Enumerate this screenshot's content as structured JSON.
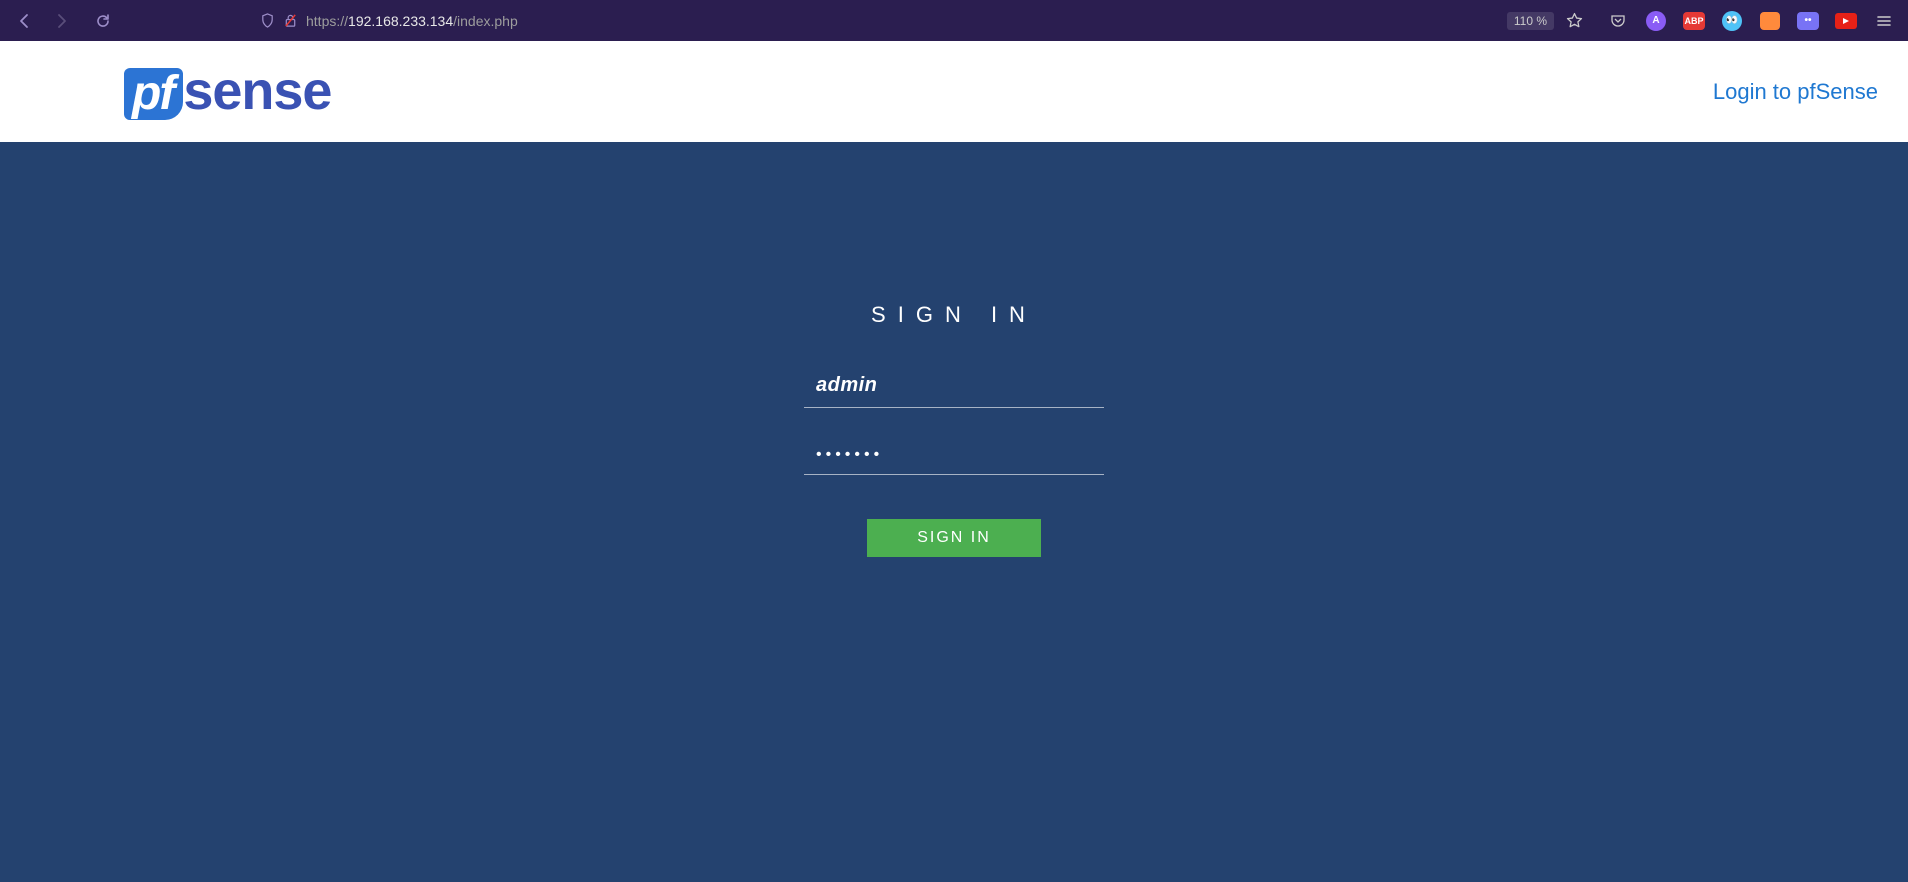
{
  "browser": {
    "url_prefix": "https://",
    "url_host": "192.168.233.134",
    "url_path": "/index.php",
    "zoom": "110 %"
  },
  "header": {
    "logo_pf": "pf",
    "logo_sense": "sense",
    "login_title": "Login to pfSense"
  },
  "login": {
    "heading": "SIGN IN",
    "username_value": "admin",
    "password_value": "•••••••",
    "button_label": "SIGN IN"
  }
}
